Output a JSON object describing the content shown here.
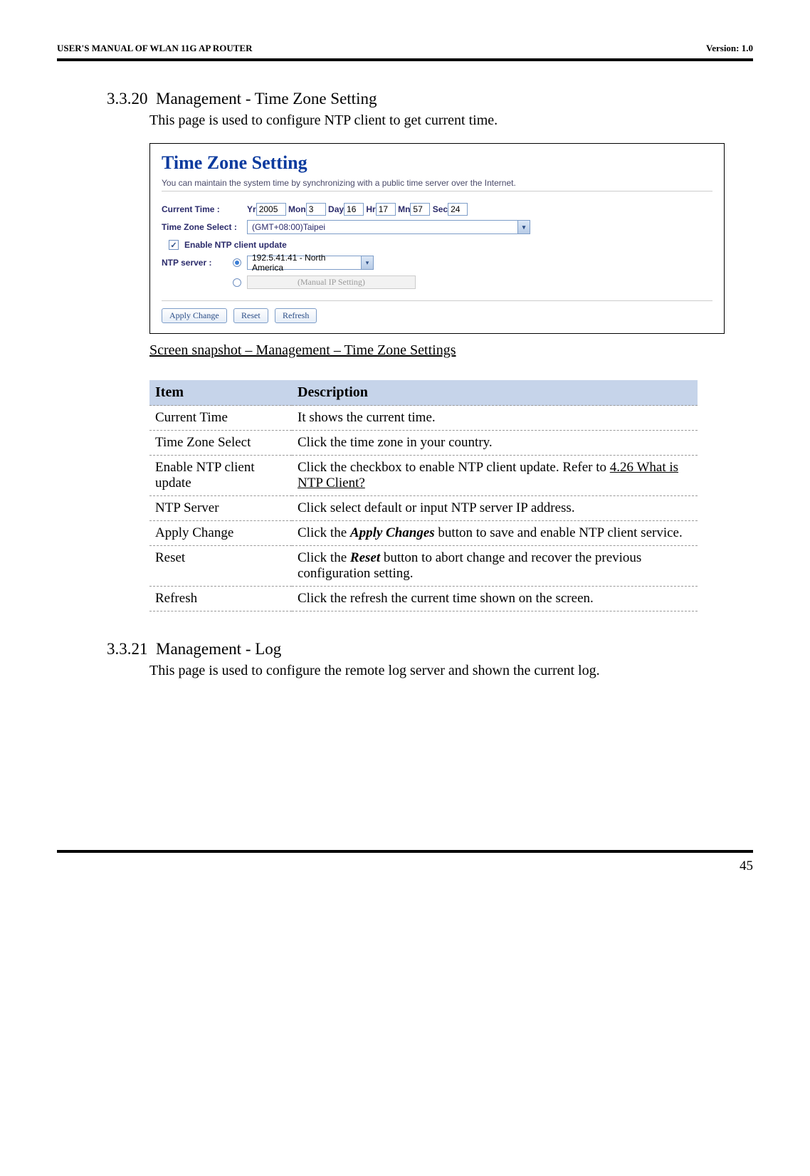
{
  "header": {
    "left": "USER'S MANUAL OF WLAN 11G AP ROUTER",
    "right": "Version: 1.0"
  },
  "section1": {
    "number": "3.3.20",
    "title": "Management - Time Zone Setting",
    "intro": "This page is used to configure NTP client to get current time."
  },
  "screenshot": {
    "title": "Time Zone Setting",
    "desc": "You can maintain the system time by synchronizing with a public time server over the Internet.",
    "current_time_label": "Current Time :",
    "yr_label": "Yr",
    "yr_val": "2005",
    "mon_label": "Mon",
    "mon_val": "3",
    "day_label": "Day",
    "day_val": "16",
    "hr_label": "Hr",
    "hr_val": "17",
    "mn_label": "Mn",
    "mn_val": "57",
    "sec_label": "Sec",
    "sec_val": "24",
    "tz_label": "Time Zone Select :",
    "tz_val": "(GMT+08:00)Taipei",
    "enable_label": "Enable NTP client update",
    "ntp_label": "NTP server :",
    "ntp_val": "192.5.41.41 - North America",
    "manual_label": "(Manual IP Setting)",
    "btn_apply": "Apply Change",
    "btn_reset": "Reset",
    "btn_refresh": "Refresh"
  },
  "caption": "Screen snapshot – Management – Time Zone Settings",
  "table": {
    "head_item": "Item",
    "head_desc": "Description",
    "rows": [
      {
        "item": "Current Time",
        "desc": "It shows the current time."
      },
      {
        "item": "Time Zone Select",
        "desc": "Click the time zone in your country."
      },
      {
        "item": "Enable NTP client update",
        "desc_pre": "Click the checkbox to enable NTP client update. Refer to ",
        "ref": "4.26 What is NTP Client?"
      },
      {
        "item": "NTP Server",
        "desc": "Click select default or input NTP server IP address."
      },
      {
        "item": "Apply Change",
        "desc_pre": "Click the ",
        "bi": "Apply Changes",
        "desc_post": " button to save and enable NTP client service."
      },
      {
        "item": "Reset",
        "desc_pre": "Click the ",
        "bi": "Reset",
        "desc_post": " button to abort change and recover the previous configuration setting."
      },
      {
        "item": "Refresh",
        "desc": "Click the refresh the current time shown on the screen."
      }
    ]
  },
  "section2": {
    "number": "3.3.21",
    "title": "Management - Log",
    "intro": "This page is used to configure the remote log server and shown the current log."
  },
  "footer": {
    "page": "45"
  }
}
